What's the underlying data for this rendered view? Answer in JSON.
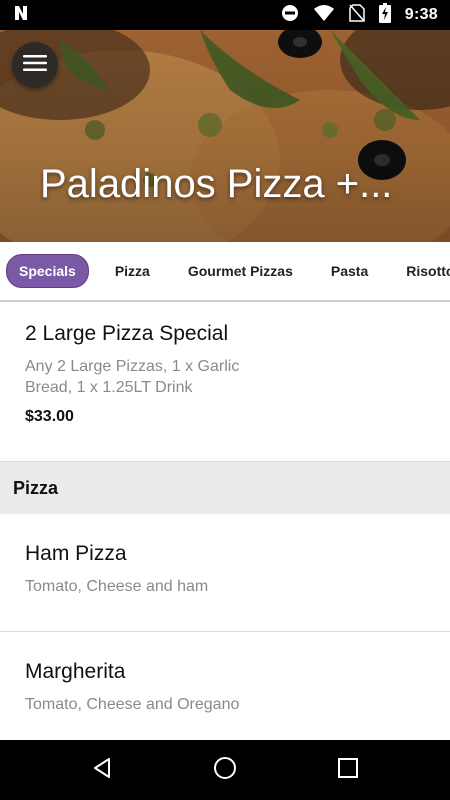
{
  "status_bar": {
    "time": "9:38",
    "icons": [
      "n-app-icon",
      "do-not-disturb-icon",
      "wifi-icon",
      "no-sim-icon",
      "battery-charging-icon"
    ]
  },
  "header": {
    "title": "Paladinos Pizza +..."
  },
  "tabs": [
    {
      "label": "Specials",
      "active": true
    },
    {
      "label": "Pizza",
      "active": false
    },
    {
      "label": "Gourmet Pizzas",
      "active": false
    },
    {
      "label": "Pasta",
      "active": false
    },
    {
      "label": "Risotto",
      "active": false
    }
  ],
  "menu": {
    "specials": [
      {
        "name": "2 Large Pizza Special",
        "description": "Any 2 Large Pizzas, 1 x Garlic Bread, 1 x 1.25LT Drink",
        "price": "$33.00"
      }
    ],
    "pizza_section": {
      "title": "Pizza",
      "items": [
        {
          "name": "Ham Pizza",
          "description": "Tomato, Cheese and ham"
        },
        {
          "name": "Margherita",
          "description": "Tomato, Cheese and Oregano"
        }
      ]
    }
  },
  "colors": {
    "accent": "#7a5aa6",
    "status_bar": "#000000",
    "section_header_bg": "#ebebeb"
  }
}
